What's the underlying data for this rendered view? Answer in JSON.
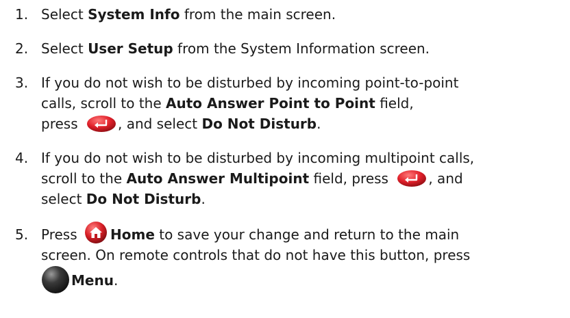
{
  "steps": [
    {
      "number": "1.",
      "pre": "Select ",
      "bold1": "System Info",
      "post": " from the main screen."
    },
    {
      "number": "2.",
      "pre": "Select ",
      "bold1": "User Setup",
      "post": " from the System Information screen."
    },
    {
      "number": "3.",
      "line1": "If you do not wish to be disturbed by incoming point-to-point",
      "line2_pre": "calls, scroll to the ",
      "line2_bold": "Auto Answer Point to Point",
      "line2_post": " field,",
      "line3_pre": "press ",
      "line3_mid": ", and select ",
      "line3_bold": "Do Not Disturb",
      "line3_post": ".",
      "icon": "enter-button-icon"
    },
    {
      "number": "4.",
      "line1": "If you do not wish to be disturbed by incoming multipoint calls,",
      "line2_pre": "scroll to the ",
      "line2_bold": "Auto Answer Multipoint",
      "line2_mid": " field, press ",
      "line2_post": ", and",
      "line3_pre": "select ",
      "line3_bold": "Do Not Disturb",
      "line3_post": ".",
      "icon": "enter-button-icon"
    },
    {
      "number": "5.",
      "line1_pre": "Press ",
      "line1_bold": "Home",
      "line1_post": " to save your change and return to the main",
      "line2": "screen. On remote controls that do not have this button, press",
      "line3_bold": "Menu",
      "line3_post": ".",
      "icons": [
        "home-button-icon",
        "menu-button-icon"
      ]
    }
  ],
  "colors": {
    "text": "#1a1a1a",
    "enter_button_red": "#e0202a",
    "home_button_red": "#d81f26",
    "menu_button_dark": "#1c1c1c"
  }
}
